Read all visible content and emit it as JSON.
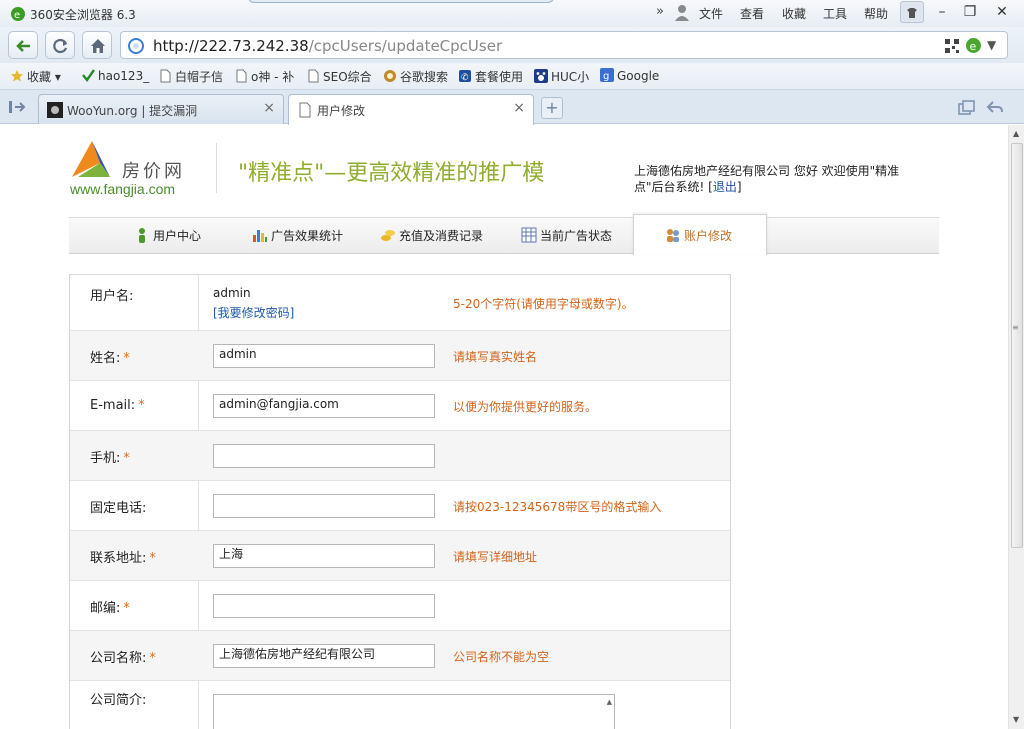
{
  "browser": {
    "title": "360安全浏览器 6.3",
    "menu": [
      "文件",
      "查看",
      "收藏",
      "工具",
      "帮助"
    ],
    "more": "»",
    "url_host": "http://222.73.242.38",
    "url_path": "/cpcUsers/updateCpcUser",
    "bookmarks": [
      "收藏",
      "hao123_",
      "白帽子信",
      "o神 - 补",
      "SEO综合",
      "谷歌搜索",
      "套餐使用",
      "HUC小",
      "Google"
    ],
    "tabs": [
      {
        "label": "WooYun.org | 提交漏洞"
      },
      {
        "label": "用户修改"
      }
    ],
    "close_glyph": "×",
    "new_tab_glyph": "+"
  },
  "header": {
    "logo_cn": "房价网",
    "logo_en": "www.fangjia.com",
    "slogan": "\"精准点\"—更高效精准的推广模",
    "welcome_text": "上海德佑房地产经纪有限公司  您好  欢迎使用\"精准点\"后台系统!  [",
    "logout": "退出",
    "welcome_end": "]"
  },
  "nav": {
    "items": [
      "用户中心",
      "广告效果统计",
      "充值及消费记录",
      "当前广告状态"
    ],
    "active": "账户修改"
  },
  "form": {
    "username_label": "用户名:",
    "username_value": "admin",
    "change_password": "[我要修改密码]",
    "username_hint": "5-20个字符(请使用字母或数字)。",
    "name_label": "姓名:",
    "name_value": "admin",
    "name_hint": "请填写真实姓名",
    "email_label": "E-mail:",
    "email_value": "admin@fangjia.com",
    "email_hint": "以便为你提供更好的服务。",
    "mobile_label": "手机:",
    "mobile_value": "",
    "phone_label": "固定电话:",
    "phone_value": "",
    "phone_hint": "请按023-12345678带区号的格式输入",
    "address_label": "联系地址:",
    "address_value": "上海",
    "address_hint": "请填写详细地址",
    "zip_label": "邮编:",
    "zip_value": "",
    "company_label": "公司名称:",
    "company_value": "上海德佑房地产经纪有限公司",
    "company_hint": "公司名称不能为空",
    "intro_label": "公司简介:",
    "required_mark": "*"
  },
  "colors": {
    "accent_green": "#8fae2e",
    "hint_orange": "#d2641a",
    "link_blue": "#1e5aa8"
  }
}
